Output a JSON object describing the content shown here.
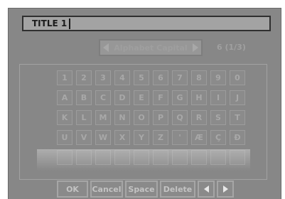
{
  "title_field": {
    "value": "TITLE 1"
  },
  "mode_selector": {
    "label": "Alphabet Capital"
  },
  "page_indicator": "6 (1/3)",
  "keys": [
    "1",
    "2",
    "3",
    "4",
    "5",
    "6",
    "7",
    "8",
    "9",
    "0",
    "A",
    "B",
    "C",
    "D",
    "E",
    "F",
    "G",
    "H",
    "I",
    "J",
    "K",
    "L",
    "M",
    "N",
    "O",
    "P",
    "Q",
    "R",
    "S",
    "T",
    "U",
    "V",
    "W",
    "X",
    "Y",
    "Z",
    "'",
    "Æ",
    "Ç",
    "Đ",
    "",
    "",
    "",
    "",
    "",
    "",
    "",
    "",
    "",
    ""
  ],
  "buttons": {
    "ok": "OK",
    "cancel": "Cancel",
    "space": "Space",
    "delete": "Delete"
  },
  "colors": {
    "panel": "#878787",
    "text_dark": "#1a1a1a",
    "key_text": "#a8a8a8"
  }
}
